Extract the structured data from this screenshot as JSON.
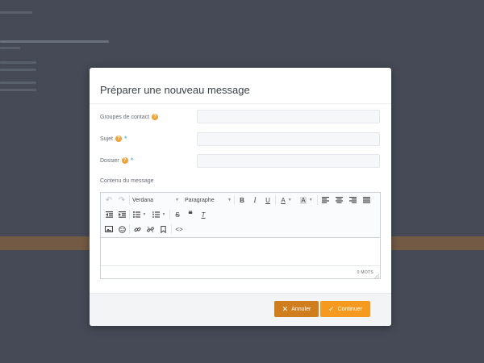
{
  "modal": {
    "title": "Préparer une nouveau message",
    "fields": {
      "groups": {
        "label": "Groupes de contact",
        "value": "",
        "required": false
      },
      "subject": {
        "label": "Sujet",
        "value": "",
        "required": true
      },
      "folder": {
        "label": "Dossier",
        "value": "",
        "required": true
      }
    },
    "content_label": "Contenu du message",
    "editor": {
      "font_family": "Verdana",
      "block_format": "Paragraphe",
      "word_count": "0 MOTS"
    },
    "buttons": {
      "cancel": "Annuler",
      "continue": "Continuer"
    }
  },
  "help_icon_glyph": "?",
  "required_glyph": "*",
  "colors": {
    "overlay_background": "#454a56",
    "help_icon": "#f0a33a",
    "required_star": "#3aa0e0",
    "cancel_button": "#d07e1d",
    "continue_button": "#f59a1e"
  },
  "icons": {
    "undo": "↶",
    "redo": "↷",
    "bold": "B",
    "italic": "I",
    "underline": "U",
    "text_color": "A",
    "bg_color": "A",
    "strike": "S",
    "quote": "❝",
    "clear": "T"
  }
}
